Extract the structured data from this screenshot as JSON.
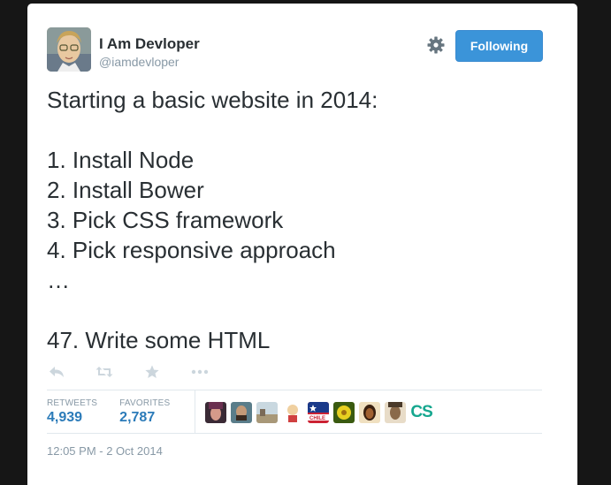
{
  "user": {
    "name": "I Am Devloper",
    "handle": "@iamdevloper"
  },
  "follow_button": {
    "label": "Following"
  },
  "tweet": {
    "lines": [
      "Starting a basic website in 2014:",
      "",
      "1. Install Node",
      "2. Install Bower",
      "3. Pick CSS framework",
      "4. Pick responsive approach",
      "…",
      "",
      "47. Write some HTML"
    ]
  },
  "actions": {
    "reply_icon": "reply-icon",
    "retweet_icon": "retweet-icon",
    "favorite_icon": "star-icon",
    "more_icon": "more-icon"
  },
  "stats": {
    "retweets_label": "RETWEETS",
    "retweets_count": "4,939",
    "favorites_label": "FAVORITES",
    "favorites_count": "2,787"
  },
  "favoriters": {
    "text_avatar": "CS",
    "avatar_colors": [
      "#c0607a",
      "#5a7d8a",
      "#a89878",
      "#d8c070",
      "#cc2233",
      "#6a8a20",
      "#a05830",
      "#8a6a4a"
    ]
  },
  "timestamp": "12:05 PM - 2 Oct 2014",
  "colors": {
    "background": "#161616",
    "follow_button": "#3b94d9",
    "count_color": "#2b7bb9",
    "muted": "#8899a6"
  }
}
